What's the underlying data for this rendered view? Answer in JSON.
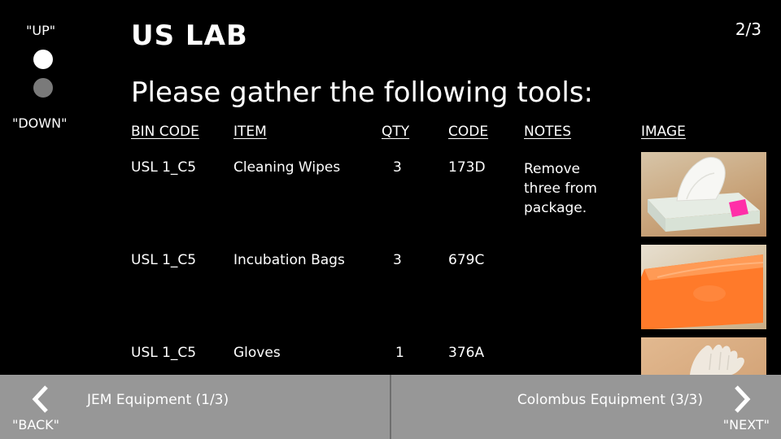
{
  "voice": {
    "up": "\"UP\"",
    "down": "\"DOWN\"",
    "back": "\"BACK\"",
    "next": "\"NEXT\""
  },
  "header": {
    "title": "US LAB",
    "page": "2/3"
  },
  "instruction": "Please gather the following tools:",
  "table": {
    "columns": [
      "BIN CODE",
      "ITEM",
      "QTY",
      "CODE",
      "NOTES",
      "IMAGE"
    ],
    "rows": [
      {
        "bin": "USL 1_C5",
        "item": "Cleaning Wipes",
        "qty": "3",
        "code": "173D",
        "notes": "Remove three from package.",
        "image": "tissue-box-image"
      },
      {
        "bin": "USL 1_C5",
        "item": "Incubation Bags",
        "qty": "3",
        "code": "679C",
        "notes": "",
        "image": "orange-bag-image"
      },
      {
        "bin": "USL 1_C5",
        "item": "Gloves",
        "qty": "1",
        "code": "376A",
        "notes": "",
        "image": "gloves-image"
      }
    ]
  },
  "footer": {
    "back_label": "JEM Equipment (1/3)",
    "next_label": "Colombus Equipment (3/3)"
  },
  "colors": {
    "background": "#000000",
    "footer": "#979797",
    "dot_active": "#ffffff",
    "dot_inactive": "#7a7a7a"
  },
  "icons": {
    "back": "chevron-left-icon",
    "next": "chevron-right-icon"
  }
}
